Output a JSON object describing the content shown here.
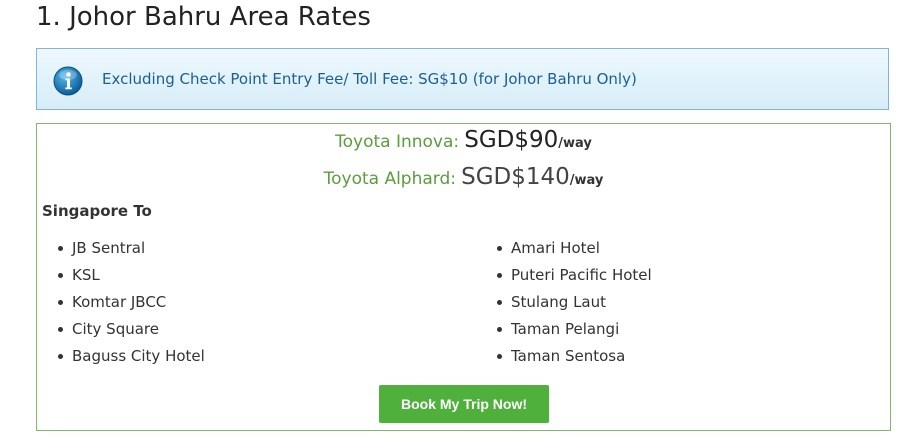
{
  "page": {
    "title": "1. Johor Bahru Area Rates"
  },
  "notice": {
    "icon": "info-icon",
    "text": "Excluding Check Point Entry Fee/ Toll Fee: SG$10 (for Johor Bahru Only)",
    "colors": {
      "text": "#1b5f92",
      "border": "#7fb6d6",
      "background": "#e4f3fa"
    }
  },
  "rates": {
    "items": [
      {
        "vehicle": "Toyota Innova:",
        "price": "SGD$90",
        "unit": "/way"
      },
      {
        "vehicle": "Toyota Alphard:",
        "price": "SGD$140",
        "unit": "/way"
      }
    ],
    "colors": {
      "vehicle": "#5a9e3c",
      "border": "#7fb86e"
    }
  },
  "destinations": {
    "heading": "Singapore To",
    "column1": [
      "JB Sentral",
      "KSL",
      "Komtar JBCC",
      "City Square",
      "Baguss City Hotel"
    ],
    "column2": [
      "Amari Hotel",
      "Puteri Pacific Hotel",
      "Stulang Laut",
      "Taman Pelangi",
      "Taman Sentosa"
    ]
  },
  "actions": {
    "book_label": "Book My Trip Now!",
    "colors": {
      "button": "#4fb03c",
      "button_text": "#ffffff"
    }
  }
}
